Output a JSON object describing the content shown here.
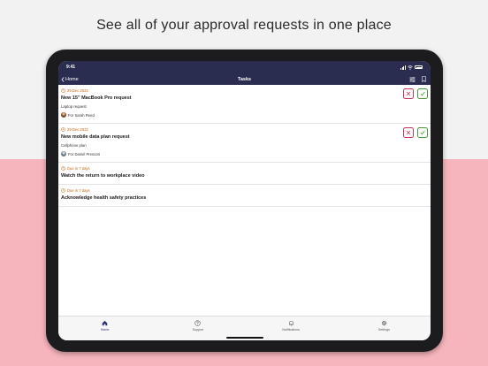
{
  "headline": "See all of your approval requests in one place",
  "status_bar": {
    "time": "9:41"
  },
  "nav": {
    "back_label": "Home",
    "title": "Tasks"
  },
  "tasks": [
    {
      "date": "29 Dec 2022",
      "title": "New 15\" MacBook Pro request",
      "subtitle": "Laptop request",
      "for": "For Sarah Reed",
      "actions": true
    },
    {
      "date": "29 Dec 2022",
      "title": "New mobile data plan request",
      "subtitle": "Cellphone plan",
      "for": "For Daniel Prescott",
      "actions": true
    },
    {
      "date": "Due in 7 days",
      "title": "Watch the return to workplace video"
    },
    {
      "date": "Due in 7 days",
      "title": "Acknowledge health safety practices"
    }
  ],
  "tabs": [
    {
      "label": "Home",
      "icon": "home-icon"
    },
    {
      "label": "Support",
      "icon": "help-icon"
    },
    {
      "label": "Notifications",
      "icon": "bell-icon"
    },
    {
      "label": "Settings",
      "icon": "gear-icon"
    }
  ],
  "colors": {
    "navbar": "#2a2d4f",
    "date_accent": "#c4650d",
    "reject": "#c8375a",
    "approve": "#4a9a3a",
    "pink_background": "#f6b4bc"
  }
}
